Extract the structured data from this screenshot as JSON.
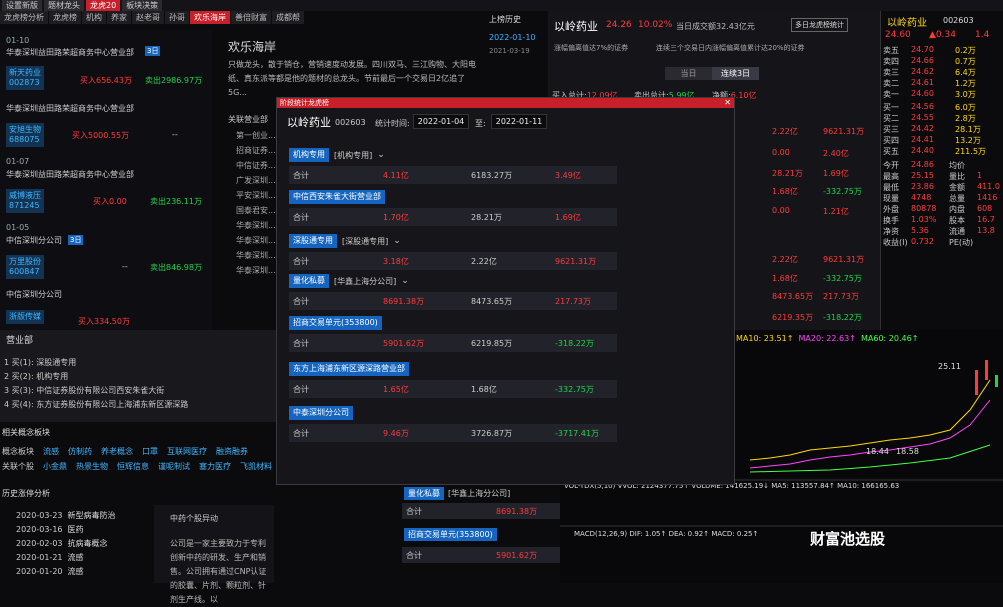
{
  "tabs_top": [
    "设置新版",
    "题材龙头",
    "龙虎20",
    "板块决策"
  ],
  "tabs_top_active": 2,
  "nav": [
    "龙虎榜分析",
    "龙虎榜",
    "机构",
    "养家",
    "赵老哥",
    "孙哥",
    "欢乐海岸",
    "善倍财富",
    "成都帮"
  ],
  "nav_active": 6,
  "left_list": [
    {
      "date": "01-10",
      "dept": "华泰深圳益田路荣超商务中心营业部",
      "badge": "3日",
      "stock": "新天药业",
      "code": "002873",
      "buy": "买入656.43万",
      "sell": "卖出2986.97万"
    },
    {
      "date": "",
      "dept": "华泰深圳益田路荣超商务中心营业部",
      "badge": "",
      "stock": "安旭生物",
      "code": "688075",
      "buy": "买入5000.55万",
      "sell": "--"
    },
    {
      "date": "01-07",
      "dept": "华泰深圳益田路荣超商务中心营业部",
      "badge": "",
      "stock": "威博液压",
      "code": "871245",
      "buy": "买入0.00",
      "sell": "卖出236.11万"
    },
    {
      "date": "01-05",
      "dept": "中信深圳分公司",
      "badge": "3日",
      "stock": "万里股份",
      "code": "600847",
      "buy": "--",
      "sell": "卖出846.98万"
    },
    {
      "date": "",
      "dept": "中信深圳分公司",
      "badge": "",
      "stock": "浙版传媒",
      "code": "",
      "buy": "买入334.50万",
      "sell": ""
    }
  ],
  "article": {
    "title": "欢乐海岸",
    "body": "只做龙头，散于销仓，营销速度动发展。四川双马、三江购物、大阳电纸、真东派等都是他的题材的总龙头。节前最后一个交易日2亿追了5G...",
    "sub_title": "关联营业部",
    "sub_items": [
      "第一创业...",
      "招商证券...",
      "中信证券...",
      "广发深圳...",
      "平安深圳...",
      "国泰君安...",
      "华泰深圳...",
      "华泰深圳...",
      "华泰深圳...",
      "华泰深圳..."
    ]
  },
  "history": {
    "title": "上榜历史",
    "dates": [
      "2022-01-10",
      "2021-03-19"
    ]
  },
  "stock_panel": {
    "name": "以岭药业",
    "price": "24.26",
    "pct": "10.02%",
    "amount": "当日成交额32.43亿元",
    "btn": "多日龙虎榜统计",
    "reason1": "涨幅偏离值达7%的证券",
    "reason2": "连续三个交易日内涨幅偏离值累计达20%的证券",
    "tab_today": "当日",
    "tab_3day": "连续3日",
    "buy_total_label": "买入总计:",
    "buy_total": "12.09亿",
    "sell_total_label": "卖出总计:",
    "sell_total": "5.99亿",
    "net_label": "净额:",
    "net": "6.10亿"
  },
  "right_rows": [
    {
      "a": "",
      "b": "2.22亿",
      "c": "9621.31万"
    },
    {
      "a": "",
      "b": "0.00",
      "c": "2.40亿"
    },
    {
      "a": "",
      "b": "28.21万",
      "c": "1.69亿"
    },
    {
      "a": "",
      "b": "1.68亿",
      "c": "-332.75万"
    },
    {
      "a": "",
      "b": "0.00",
      "c": "1.21亿"
    },
    {
      "a": "",
      "b": "2.22亿",
      "c": "9621.31万"
    },
    {
      "a": "",
      "b": "1.68亿",
      "c": "-332.75万"
    },
    {
      "a": "",
      "b": "8473.65万",
      "c": "217.73万"
    },
    {
      "a": "",
      "b": "6219.35万",
      "c": "-318.22万"
    }
  ],
  "quote": {
    "name": "以岭药业",
    "code": "002603",
    "price": "24.60",
    "chg": "▲0.34",
    "pct": "1.4",
    "asks": [
      [
        "卖五",
        "24.70",
        "0.2万"
      ],
      [
        "卖四",
        "24.66",
        "0.7万"
      ],
      [
        "卖三",
        "24.62",
        "6.4万"
      ],
      [
        "卖二",
        "24.61",
        "1.2万"
      ],
      [
        "卖一",
        "24.60",
        "3.0万"
      ]
    ],
    "bids": [
      [
        "买一",
        "24.56",
        "6.0万"
      ],
      [
        "买二",
        "24.55",
        "2.8万"
      ],
      [
        "买三",
        "24.42",
        "28.1万"
      ],
      [
        "买四",
        "24.41",
        "13.2万"
      ],
      [
        "买五",
        "24.40",
        "211.5万"
      ]
    ],
    "stats": [
      [
        "今开",
        "24.86",
        "均价",
        ""
      ],
      [
        "最高",
        "25.15",
        "量比",
        "1"
      ],
      [
        "最低",
        "23.86",
        "金额",
        "411.0"
      ],
      [
        "现量",
        "4748",
        "总量",
        "1416"
      ],
      [
        "外盘",
        "80878",
        "内盘",
        "608"
      ],
      [
        "换手",
        "1.03%",
        "股本",
        "16.7"
      ],
      [
        "净资",
        "5.36",
        "流通",
        "13.8"
      ],
      [
        "收益(Ⅰ)",
        "0.732",
        "PE(动)",
        ""
      ]
    ]
  },
  "dialog": {
    "title": "阶段统计龙虎榜",
    "stock": "以岭药业",
    "code": "002603",
    "period_label": "统计时间:",
    "from": "2022-01-04",
    "to_label": "至:",
    "to": "2022-01-11",
    "blocks": [
      {
        "tag": "机构专用",
        "sub": "[机构专用]",
        "label": "合计",
        "a": "4.11亿",
        "b": "6183.27万",
        "c": "3.49亿"
      },
      {
        "tag": "中信西安朱雀大街营业部",
        "sub": "",
        "label": "合计",
        "a": "1.70亿",
        "b": "28.21万",
        "c": "1.69亿"
      },
      {
        "tag": "深股通专用",
        "sub": "[深股通专用]",
        "label": "合计",
        "a": "3.18亿",
        "b": "2.22亿",
        "c": "9621.31万"
      },
      {
        "tag": "量化私募",
        "sub": "[华鑫上海分公司]",
        "label": "合计",
        "a": "8691.38万",
        "b": "8473.65万",
        "c": "217.73万"
      },
      {
        "tag": "招商交易单元(353800)",
        "sub": "",
        "label": "合计",
        "a": "5901.62万",
        "b": "6219.85万",
        "c": "-318.22万"
      },
      {
        "tag": "东方上海浦东新区源深路营业部",
        "sub": "",
        "label": "合计",
        "a": "1.65亿",
        "b": "1.68亿",
        "c": "-332.75万"
      },
      {
        "tag": "中泰深圳分公司",
        "sub": "",
        "label": "合计",
        "a": "9.46万",
        "b": "3726.87万",
        "c": "-3717.41万"
      }
    ]
  },
  "yingye": {
    "title": "营业部",
    "items": [
      "1   买(1): 深股通专用",
      "2   买(2): 机构专用",
      "3   买(3): 中信证券股份有限公司西安朱雀大街",
      "4   买(4): 东方证券股份有限公司上海浦东新区源深路"
    ]
  },
  "concept": {
    "title": "相关概念板块",
    "row1": [
      "概念板块",
      "流感",
      "仿制药",
      "养老概念",
      "口罩",
      "互联网医疗",
      "融资融券"
    ],
    "row2": [
      "关联个股",
      "小金鼎",
      "热景生物",
      "恒辉信息",
      "谨呢制试",
      "塞力医疗",
      "飞凯材料"
    ]
  },
  "hist2": {
    "title": "历史涨停分析",
    "items": [
      [
        "2020-03-23",
        "新型病毒防治"
      ],
      [
        "2020-03-16",
        "医药"
      ],
      [
        "2020-02-03",
        "抗病毒概念"
      ],
      [
        "2020-01-21",
        "流感"
      ],
      [
        "2020-01-20",
        "流感"
      ]
    ]
  },
  "company": {
    "title": "中药个股异动",
    "body": "公司是一家主要致力于专利创新中药的研发、生产和销售。公司拥有通过CNP认证的胶囊、片剂、颗粒剂、针剂生产线。以"
  },
  "bottom_blocks": [
    {
      "tag": "量化私募",
      "sub": "[华鑫上海分公司]",
      "a": "8691.38万"
    },
    {
      "tag": "招商交易单元(353800)",
      "sub": "",
      "a": "5901.62万"
    }
  ],
  "chart": {
    "ma10": "MA10: 23.51↑",
    "ma20": "MA20: 22.63↑",
    "ma60": "MA60: 20.46↑",
    "high": "25.11",
    "low1": "18.44",
    "low2": "18.58",
    "vol": "VOL-TDX(5,10) VVOL: 2124377.75↑ VOLUME: 141625.19↓ MA5: 113557.84↑ MA10: 166165.63",
    "macd": "MACD(12,26,9) DIF: 1.05↑ DEA: 0.92↑ MACD: 0.25↑"
  },
  "watermark": "财富池选股",
  "colors": {
    "up": "#ff3b3b",
    "down": "#1fd34b",
    "accent": "#c8202a",
    "link": "#3fb6ff"
  }
}
